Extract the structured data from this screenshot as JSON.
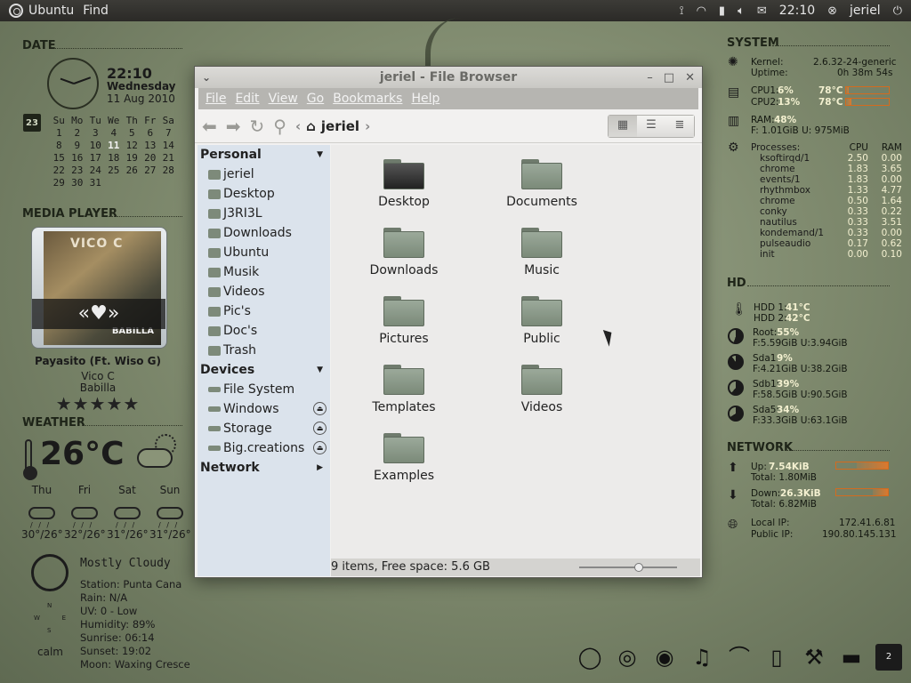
{
  "top_panel": {
    "app_menu": "Ubuntu",
    "find": "Find",
    "time": "22:10",
    "user": "jeriel"
  },
  "date_widget": {
    "title": "DATE",
    "time": "22:10",
    "weekday": "Wednesday",
    "date": "11 Aug 2010",
    "cal_icon": "23",
    "calendar_header": [
      "Su",
      "Mo",
      "Tu",
      "We",
      "Th",
      "Fr",
      "Sa"
    ],
    "calendar_rows": [
      [
        "",
        "",
        "",
        "",
        "",
        "",
        ""
      ],
      [
        "1",
        "2",
        "3",
        "4",
        "5",
        "6",
        "7"
      ],
      [
        "8",
        "9",
        "10",
        "11",
        "12",
        "13",
        "14"
      ],
      [
        "15",
        "16",
        "17",
        "18",
        "19",
        "20",
        "21"
      ],
      [
        "22",
        "23",
        "24",
        "25",
        "26",
        "27",
        "28"
      ],
      [
        "29",
        "30",
        "31",
        "",
        "",
        "",
        ""
      ]
    ],
    "today": "11"
  },
  "media_player": {
    "title": "MEDIA PLAYER",
    "art_title": "VICO C",
    "art_bottom": "BABILLA",
    "song": "Payasito (Ft. Wiso G)",
    "artist": "Vico C",
    "album": "Babilla",
    "rating": "★★★★★"
  },
  "weather": {
    "title": "WEATHER",
    "temp": "26°C",
    "forecast": [
      {
        "day": "Thu",
        "range": "30°/26°"
      },
      {
        "day": "Fri",
        "range": "32°/26°"
      },
      {
        "day": "Sat",
        "range": "31°/26°"
      },
      {
        "day": "Sun",
        "range": "31°/26°"
      }
    ],
    "description": "Mostly Cloudy",
    "details": [
      "Station: Punta Cana",
      "Rain: N/A",
      "UV: 0 - Low",
      "Humidity: 89%",
      "Sunrise: 06:14",
      "Sunset: 19:02",
      "Moon: Waxing Cresce"
    ],
    "wind": "calm"
  },
  "system": {
    "title": "SYSTEM",
    "kernel_label": "Kernel:",
    "kernel": "2.6.32-24-generic",
    "uptime_label": "Uptime:",
    "uptime": "0h 38m 54s",
    "cpu1_label": "CPU1:",
    "cpu1": "6%",
    "cpu1_temp": "78°C",
    "cpu2_label": "CPU2:",
    "cpu2": "13%",
    "cpu2_temp": "78°C",
    "ram_label": "RAM:",
    "ram": "48%",
    "ram_detail": "F: 1.01GiB U: 975MiB",
    "processes_label": "Processes:",
    "cpu_col": "CPU",
    "ram_col": "RAM",
    "processes": [
      {
        "name": "ksoftirqd/1",
        "cpu": "2.50",
        "ram": "0.00"
      },
      {
        "name": "chrome",
        "cpu": "1.83",
        "ram": "3.65"
      },
      {
        "name": "events/1",
        "cpu": "1.83",
        "ram": "0.00"
      },
      {
        "name": "rhythmbox",
        "cpu": "1.33",
        "ram": "4.77"
      },
      {
        "name": "chrome",
        "cpu": "0.50",
        "ram": "1.64"
      },
      {
        "name": "conky",
        "cpu": "0.33",
        "ram": "0.22"
      },
      {
        "name": "nautilus",
        "cpu": "0.33",
        "ram": "3.51"
      },
      {
        "name": "kondemand/1",
        "cpu": "0.33",
        "ram": "0.00"
      },
      {
        "name": "pulseaudio",
        "cpu": "0.17",
        "ram": "0.62"
      },
      {
        "name": "init",
        "cpu": "0.00",
        "ram": "0.10"
      }
    ],
    "cpu1_level": 0.06,
    "cpu2_level": 0.13,
    "ram_level": 0.48
  },
  "hd": {
    "title": "HD",
    "hdd1_label": "HDD 1:",
    "hdd1": "41°C",
    "hdd2_label": "HDD 2:",
    "hdd2": "42°C",
    "partitions": [
      {
        "name": "Root:",
        "pct": "55%",
        "detail": "F:5.59GiB U:3.94GiB",
        "level": 0.55
      },
      {
        "name": "Sda1:",
        "pct": "9%",
        "detail": "F:4.21GiB U:38.2GiB",
        "level": 0.9
      },
      {
        "name": "Sdb1:",
        "pct": "39%",
        "detail": "F:58.5GiB U:90.5GiB",
        "level": 0.61
      },
      {
        "name": "Sda5:",
        "pct": "34%",
        "detail": "F:33.3GiB U:63.1GiB",
        "level": 0.66
      }
    ]
  },
  "network": {
    "title": "NETWORK",
    "up_label": "Up:",
    "up": "7.54KiB",
    "up_total": "Total: 1.80MiB",
    "down_label": "Down:",
    "down": "26.3KiB",
    "down_total": "Total: 6.82MiB",
    "local_ip_label": "Local IP:",
    "local_ip": "172.41.6.81",
    "public_ip_label": "Public IP:",
    "public_ip": "190.80.145.131"
  },
  "file_browser": {
    "title": "jeriel - File Browser",
    "menu": [
      "File",
      "Edit",
      "View",
      "Go",
      "Bookmarks",
      "Help"
    ],
    "breadcrumb": "jeriel",
    "sidebar": {
      "personal_label": "Personal",
      "personal": [
        "jeriel",
        "Desktop",
        "J3RI3L",
        "Downloads",
        "Ubuntu",
        "Musik",
        "Videos",
        "Pic's",
        "Doc's",
        "Trash"
      ],
      "devices_label": "Devices",
      "devices": [
        "File System",
        "Windows",
        "Storage",
        "Big.creations"
      ],
      "network_label": "Network"
    },
    "files": [
      "Desktop",
      "Documents",
      "Downloads",
      "Music",
      "Pictures",
      "Public",
      "Templates",
      "Videos",
      "Examples"
    ],
    "status": "9 items, Free space: 5.6 GB"
  },
  "dock": {
    "badge": "2"
  }
}
